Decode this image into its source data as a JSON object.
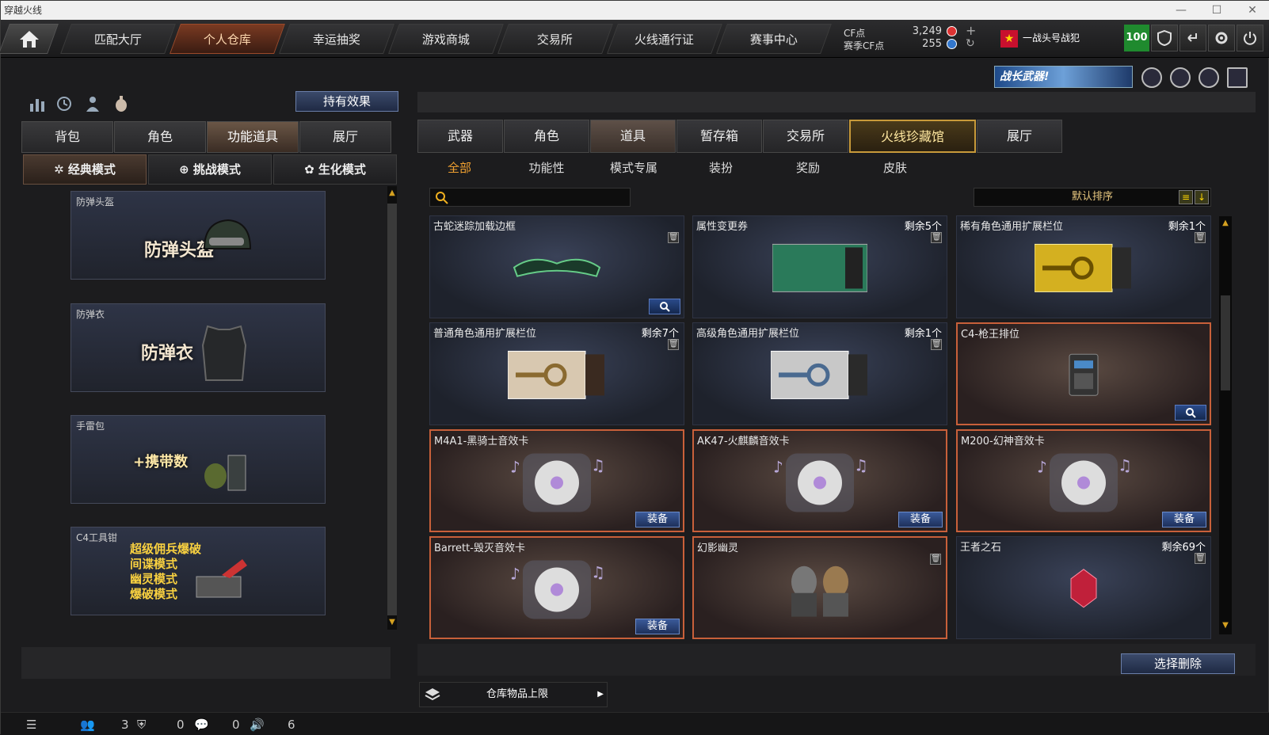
{
  "window": {
    "title": "穿越火线"
  },
  "topnav": {
    "tabs": [
      {
        "label": "匹配大厅"
      },
      {
        "label": "个人仓库",
        "active": true
      },
      {
        "label": "幸运抽奖"
      },
      {
        "label": "游戏商城"
      },
      {
        "label": "交易所"
      },
      {
        "label": "火线通行证"
      },
      {
        "label": "赛事中心"
      }
    ],
    "cf_label": "CF点",
    "cf_value": "3,249",
    "season_cf_label": "赛季CF点",
    "season_cf_value": "255",
    "rank_label": "一战头号战犯",
    "level": "100"
  },
  "banner": {
    "text": "战长武器!"
  },
  "left": {
    "hold_effect_button": "持有效果",
    "tabs": [
      "背包",
      "角色",
      "功能道具",
      "展厅"
    ],
    "active_tab": "功能道具",
    "modes": [
      "经典模式",
      "挑战模式",
      "生化模式"
    ],
    "active_mode": "经典模式",
    "cards": [
      {
        "caption": "防弹头盔",
        "big": "防弹头盔"
      },
      {
        "caption": "防弹衣",
        "big": "防弹衣"
      },
      {
        "caption": "手雷包",
        "big": "+携带数"
      },
      {
        "caption": "C4工具钳",
        "lines": [
          "超级佣兵爆破",
          "间谍模式",
          "幽灵模式",
          "爆破模式"
        ]
      }
    ]
  },
  "right": {
    "tabs": [
      "武器",
      "角色",
      "道具",
      "暂存箱",
      "交易所",
      "火线珍藏馆",
      "展厅"
    ],
    "active_tab": "道具",
    "subtabs": [
      "全部",
      "功能性",
      "模式专属",
      "装扮",
      "奖励",
      "皮肤"
    ],
    "active_subtab": "全部",
    "search_placeholder": "",
    "sort_label": "默认排序",
    "items": [
      {
        "name": "古蛇迷踪加载边框",
        "count": "",
        "trash": true,
        "button": "search",
        "art": "frame"
      },
      {
        "name": "属性变更券",
        "count": "剩余5个",
        "trash": true,
        "art": "ticket-green"
      },
      {
        "name": "稀有角色通用扩展栏位",
        "count": "剩余1个",
        "trash": true,
        "art": "key-gold"
      },
      {
        "name": "普通角色通用扩展栏位",
        "count": "剩余7个",
        "trash": true,
        "art": "key-beige"
      },
      {
        "name": "高级角色通用扩展栏位",
        "count": "剩余1个",
        "trash": true,
        "art": "key-silver"
      },
      {
        "name": "C4-枪王排位",
        "count": "",
        "trash": false,
        "button": "search",
        "selected": true,
        "art": "c4"
      },
      {
        "name": "M4A1-黑骑士音效卡",
        "count": "",
        "trash": false,
        "button": "装备",
        "selected": true,
        "art": "cd"
      },
      {
        "name": "AK47-火麒麟音效卡",
        "count": "",
        "trash": false,
        "button": "装备",
        "selected": true,
        "art": "cd"
      },
      {
        "name": "M200-幻神音效卡",
        "count": "",
        "trash": false,
        "button": "装备",
        "selected": true,
        "art": "cd"
      },
      {
        "name": "Barrett-毁灭音效卡",
        "count": "",
        "trash": false,
        "button": "装备",
        "selected": true,
        "art": "cd"
      },
      {
        "name": "幻影幽灵",
        "count": "",
        "trash": true,
        "selected": true,
        "art": "ghosts"
      },
      {
        "name": "王者之石",
        "count": "剩余69个",
        "trash": true,
        "art": "gem"
      }
    ],
    "delete_button": "选择删除",
    "capacity_label": "仓库物品上限"
  },
  "status": {
    "v1": "3",
    "v2": "0",
    "v3": "0",
    "v4": "6"
  }
}
